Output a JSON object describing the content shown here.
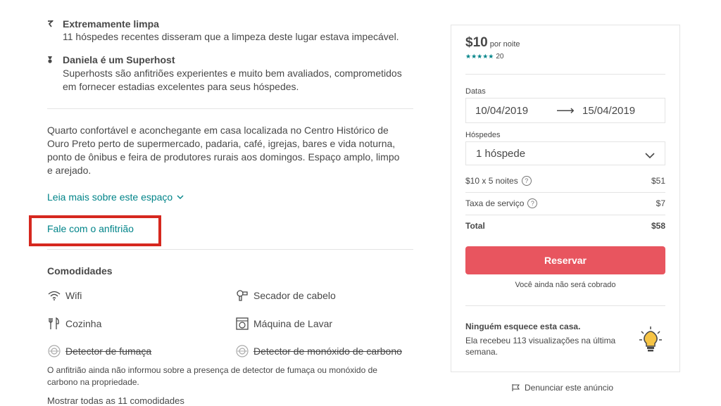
{
  "highlights": [
    {
      "icon": "sparkle-icon",
      "title": "Extremamente limpa",
      "desc": "11 hóspedes recentes disseram que a limpeza deste lugar estava impecável."
    },
    {
      "icon": "medal-icon",
      "title": "Daniela é um Superhost",
      "desc_line1": "Superhosts são anfitriões experientes e muito bem avaliados, comprometidos",
      "desc_line2": "em fornecer estadias excelentes para seus hóspedes."
    }
  ],
  "description": {
    "line1": "Quarto confortável e aconchegante em casa localizada no Centro Histórico de",
    "line2": "Ouro Preto perto de supermercado, padaria, café, igrejas, bares e vida noturna,",
    "line3": "ponto de ônibus e feira de produtores rurais aos domingos. Espaço amplo, limpo",
    "line4": "e arejado."
  },
  "links": {
    "read_more": "Leia mais sobre este espaço",
    "contact_host": "Fale com o anfitrião"
  },
  "amenities": {
    "heading": "Comodidades",
    "items": [
      {
        "label": "Wifi",
        "icon": "wifi-icon",
        "unavailable": false
      },
      {
        "label": "Secador de cabelo",
        "icon": "hair-dryer-icon",
        "unavailable": false
      },
      {
        "label": "Cozinha",
        "icon": "kitchen-icon",
        "unavailable": false
      },
      {
        "label": "Máquina de Lavar",
        "icon": "washer-icon",
        "unavailable": false
      },
      {
        "label": "Detector de fumaça",
        "icon": "smoke-detector-icon",
        "unavailable": true
      },
      {
        "label": "Detector de monóxido de carbono",
        "icon": "co-detector-icon",
        "unavailable": true
      }
    ],
    "note_line1": "O anfitrião ainda não informou sobre a presença de detector de fumaça ou monóxido de",
    "note_line2": "carbono na propriedade.",
    "cut_off_text": "Mostrar todas as 11 comodidades"
  },
  "booking": {
    "price": "$10",
    "per_night": "por noite",
    "stars": "★★★★★",
    "rating_count": "20",
    "dates_label": "Datas",
    "checkin": "10/04/2019",
    "arrow": "⟶",
    "checkout": "15/04/2019",
    "guests_label": "Hóspedes",
    "guests_value": "1 hóspede",
    "nightly_label": "$10 x 5 noites",
    "nightly_value": "$51",
    "service_label": "Taxa de serviço",
    "service_value": "$7",
    "total_label": "Total",
    "total_value": "$58",
    "reserve_button": "Reservar",
    "no_charge": "Você ainda não será cobrado",
    "popular_title": "Ninguém esquece esta casa.",
    "popular_line1": "Ela recebeu 113 visualizações na última",
    "popular_line2": "semana.",
    "report": "Denunciar este anúncio"
  },
  "colors": {
    "accent_teal": "#008489",
    "reserve_red": "#e8555f",
    "highlight_box": "#d6281f"
  }
}
